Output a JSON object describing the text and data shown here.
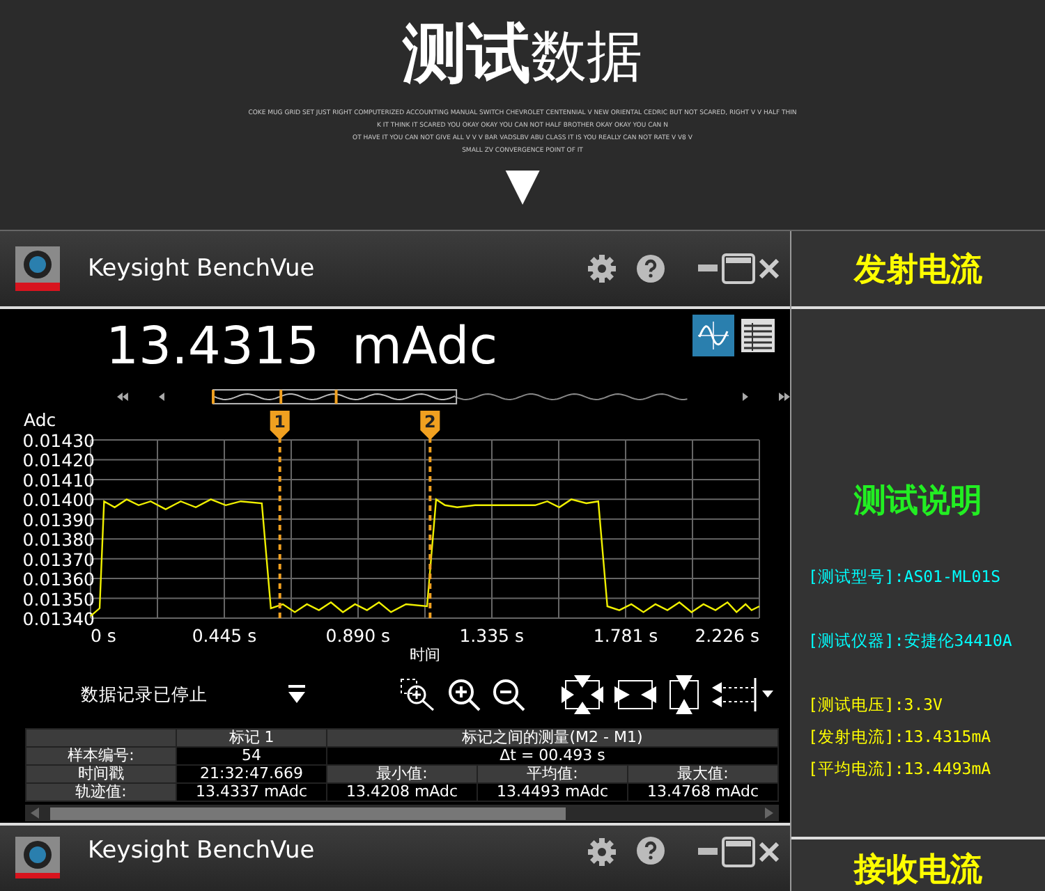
{
  "header": {
    "title": "**测试**数据",
    "subtitle_lines": [
      "COKE MUG GRID SET JUST RIGHT COMPUTERIZED ACCOUNTING MANUAL SWITCH CHEVROLET CENTENNIAL V NEW ORIENTAL CEDRIC BUT NOT SCARED, RIGHT V V HALF THIN",
      "K IT THINK IT SCARED YOU OKAY OKAY YOU CAN NOT HALF BROTHER OKAY OKAY YOU CAN N",
      "OT HAVE IT YOU CAN NOT GIVE ALL V V V BAR VADSLBV ABU CLASS IT IS YOU REALLY CAN NOT RATE V V8 V",
      "SMALL ZV CONVERGENCE POINT OF IT"
    ],
    "arrow": "▼"
  },
  "app_window": {
    "title": "Keysight BenchVue",
    "reading": "13.4315  mAdc",
    "views": [
      {
        "kind": "chart",
        "selected": true
      },
      {
        "kind": "table",
        "selected": false
      }
    ],
    "chart_data": {
      "type": "line",
      "ylabel": "Adc",
      "xlabel": "时间",
      "xlim": [
        0,
        2.226
      ],
      "ylim": [
        0.0134,
        0.0143
      ],
      "xticks": [
        {
          "value": 0,
          "label": "0 s"
        },
        {
          "value": 0.445,
          "label": "0.445 s"
        },
        {
          "value": 0.89,
          "label": "0.890 s"
        },
        {
          "value": 1.335,
          "label": "1.335 s"
        },
        {
          "value": 1.781,
          "label": "1.781 s"
        },
        {
          "value": 2.226,
          "label": "2.226 s"
        }
      ],
      "yticks": [
        {
          "value": 0.0143,
          "label": "0.01430"
        },
        {
          "value": 0.0142,
          "label": "0.01420"
        },
        {
          "value": 0.0141,
          "label": "0.01410"
        },
        {
          "value": 0.014,
          "label": "0.01400"
        },
        {
          "value": 0.0139,
          "label": "0.01390"
        },
        {
          "value": 0.0138,
          "label": "0.01380"
        },
        {
          "value": 0.0137,
          "label": "0.01370"
        },
        {
          "value": 0.0136,
          "label": "0.01360"
        },
        {
          "value": 0.0135,
          "label": "0.01350"
        },
        {
          "value": 0.0134,
          "label": "0.01340"
        }
      ],
      "x": [
        0,
        0.03,
        0.045,
        0.08,
        0.12,
        0.16,
        0.2,
        0.25,
        0.3,
        0.35,
        0.4,
        0.45,
        0.5,
        0.57,
        0.6,
        0.64,
        0.68,
        0.72,
        0.76,
        0.8,
        0.84,
        0.88,
        0.92,
        0.96,
        1.0,
        1.05,
        1.12,
        1.15,
        1.18,
        1.22,
        1.28,
        1.35,
        1.42,
        1.48,
        1.52,
        1.56,
        1.6,
        1.65,
        1.69,
        1.72,
        1.76,
        1.8,
        1.84,
        1.88,
        1.92,
        1.96,
        2.0,
        2.04,
        2.08,
        2.12,
        2.15,
        2.18,
        2.2,
        2.226
      ],
      "grid": true,
      "series": [
        {
          "color": "#f0f000",
          "values": [
            0.01341,
            0.01345,
            0.01399,
            0.01396,
            0.014,
            0.01397,
            0.01399,
            0.01395,
            0.01399,
            0.01396,
            0.014,
            0.01397,
            0.01399,
            0.01398,
            0.01345,
            0.01347,
            0.01343,
            0.01347,
            0.01344,
            0.01348,
            0.01343,
            0.01347,
            0.01344,
            0.01348,
            0.01343,
            0.01347,
            0.01346,
            0.014,
            0.01397,
            0.01396,
            0.01397,
            0.01397,
            0.01397,
            0.01397,
            0.01399,
            0.01396,
            0.014,
            0.01398,
            0.01399,
            0.01346,
            0.01344,
            0.01347,
            0.01343,
            0.01347,
            0.01344,
            0.01348,
            0.01343,
            0.01347,
            0.01344,
            0.01348,
            0.01343,
            0.01347,
            0.01344,
            0.01346
          ]
        }
      ],
      "ref_lines": [
        {
          "axis": "x",
          "value": 0.63
        },
        {
          "axis": "x",
          "value": 1.13
        }
      ]
    },
    "marker_tags": [
      "1",
      "2"
    ],
    "status": "数据记录已停止",
    "table": {
      "headers": [
        "标记 1",
        "标记之间的测量(M2 - M1)"
      ],
      "sample_row": {
        "label": "样本编号:",
        "value": "54",
        "delta": "Δt = 00.493 s"
      },
      "stats_header_row": {
        "label": "时间戳",
        "value": "21:32:47.669",
        "stats": [
          "最小值:",
          "平均值:",
          "最大值:"
        ]
      },
      "stats_value_row": {
        "label": "轨迹值:",
        "value": "13.4337 mAdc",
        "stats": [
          "13.4208 mAdc",
          "13.4493 mAdc",
          "13.4768 mAdc"
        ]
      }
    }
  },
  "second_window": {
    "title": "Keysight BenchVue"
  },
  "side": {
    "heading": "发射电流",
    "section_title": "测试说明",
    "line_groups": [
      [
        {
          "text": "[测试型号]:AS01-ML01S",
          "color": "#00ffff"
        }
      ],
      [
        {
          "text": "[测试仪器]:安捷伦34410A",
          "color": "#00ffff"
        }
      ],
      [
        {
          "text": "[测试电压]:3.3V",
          "color": "#ffff00"
        },
        {
          "text": "[发射电流]:13.4315mA",
          "color": "#ffff00"
        },
        {
          "text": "[平均电流]:13.4493mA",
          "color": "#ffff00"
        }
      ]
    ],
    "footer_heading": "接收电流"
  }
}
